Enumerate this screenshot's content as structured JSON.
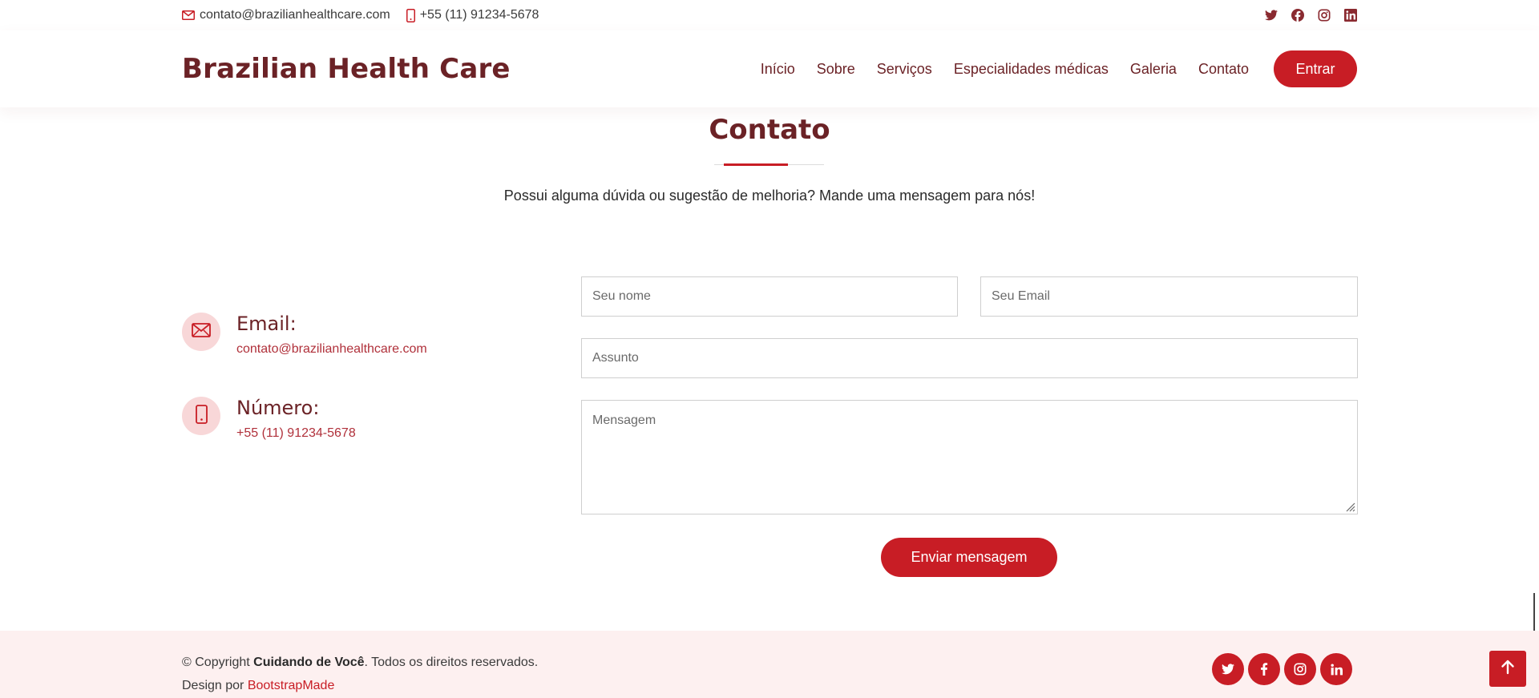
{
  "topbar": {
    "email": "contato@brazilianhealthcare.com",
    "phone": "+55 (11) 91234-5678",
    "social_icons": [
      "twitter-icon",
      "facebook-icon",
      "instagram-icon",
      "linkedin-icon"
    ]
  },
  "header": {
    "logo": "Brazilian Health Care",
    "nav": [
      "Início",
      "Sobre",
      "Serviços",
      "Especialidades médicas",
      "Galeria",
      "Contato"
    ],
    "login_label": "Entrar"
  },
  "contact": {
    "title": "Contato",
    "description": "Possui alguma dúvida ou sugestão de melhoria? Mande uma mensagem para nós!",
    "email_label": "Email:",
    "email_value": "contato@brazilianhealthcare.com",
    "phone_label": "Número:",
    "phone_value": "+55 (11) 91234-5678"
  },
  "form": {
    "name_placeholder": "Seu nome",
    "email_placeholder": "Seu Email",
    "subject_placeholder": "Assunto",
    "message_placeholder": "Mensagem",
    "submit_label": "Enviar mensagem"
  },
  "footer": {
    "copyright_prefix": "© Copyright ",
    "copyright_brand": "Cuidando de Você",
    "copyright_suffix": ". Todos os direitos reservados.",
    "design_prefix": "Design por ",
    "design_link": "BootstrapMade",
    "social_icons": [
      "twitter-icon",
      "facebook-icon",
      "instagram-icon",
      "linkedin-icon"
    ]
  },
  "colors": {
    "accent": "#c81d25",
    "brand_dark": "#6b2226",
    "footer_bg": "#fdf0f0",
    "icon_circle": "#f8d7d8"
  }
}
